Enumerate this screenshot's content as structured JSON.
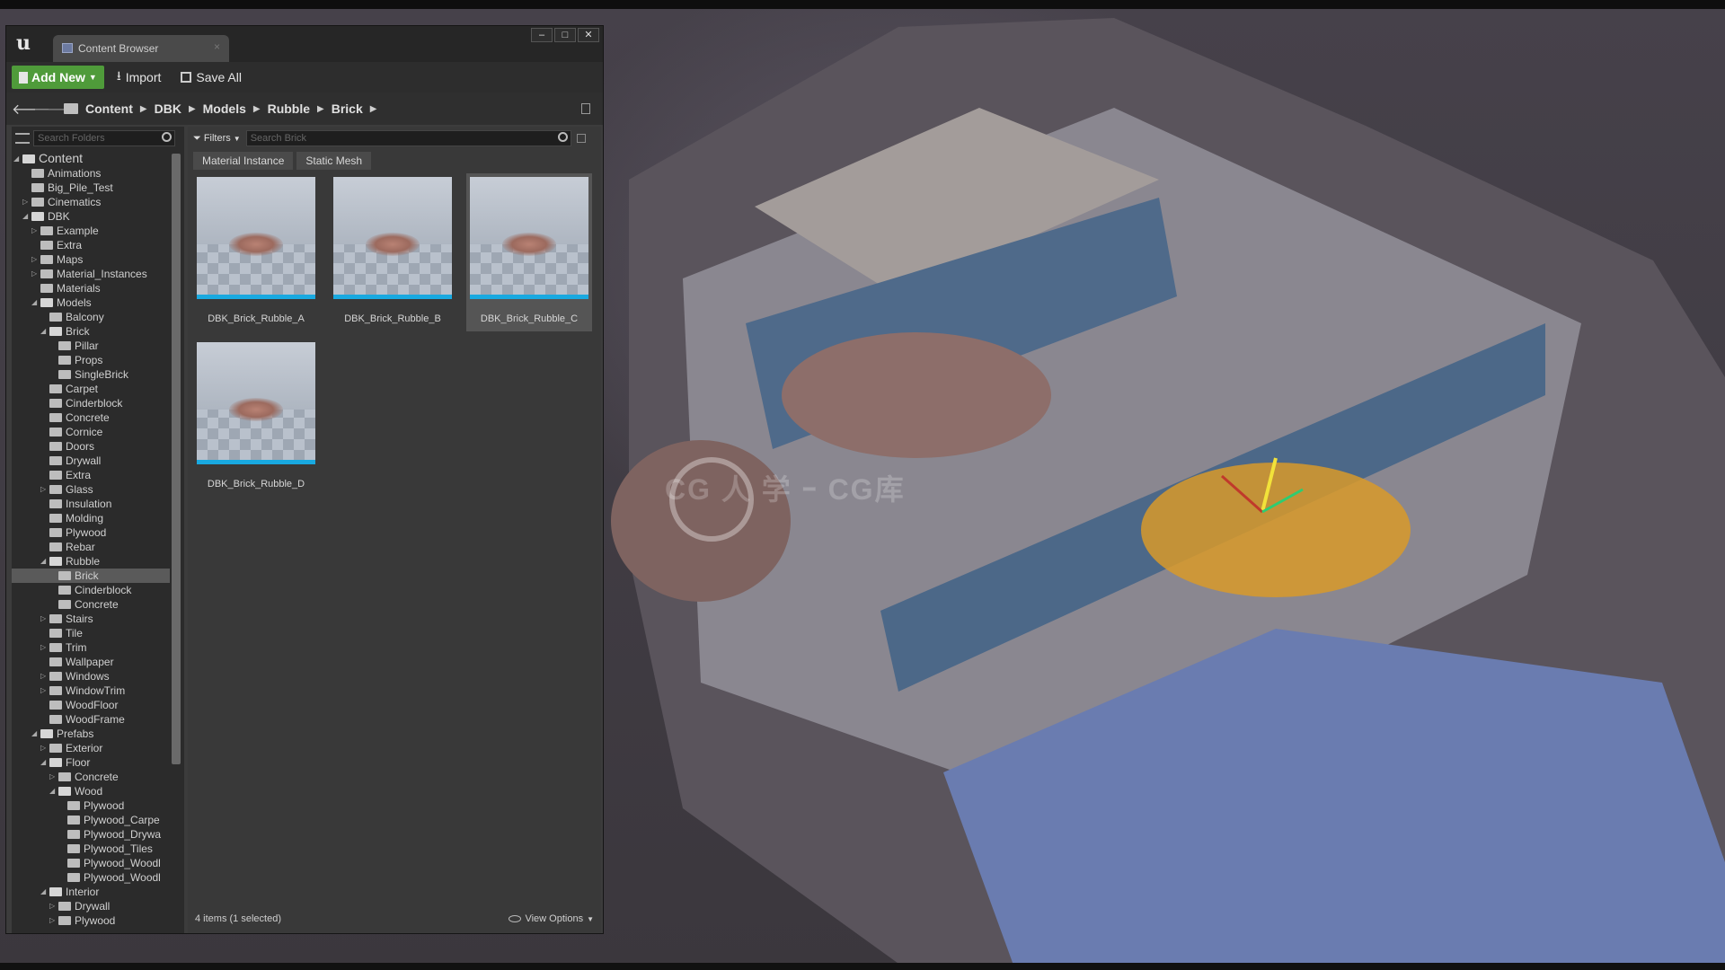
{
  "window": {
    "tab_title": "Content Browser",
    "controls": [
      "–",
      "□",
      "✕"
    ]
  },
  "toolbar": {
    "add_new_label": "Add New",
    "import_label": "Import",
    "save_all_label": "Save All"
  },
  "breadcrumb": [
    "Content",
    "DBK",
    "Models",
    "Rubble",
    "Brick"
  ],
  "folder_search": {
    "placeholder": "Search Folders"
  },
  "asset_search": {
    "placeholder": "Search Brick",
    "filters_label": "Filters"
  },
  "filter_chips": [
    "Material Instance",
    "Static Mesh"
  ],
  "tree": [
    {
      "label": "Content",
      "depth": 0,
      "toggle": "open",
      "root": true
    },
    {
      "label": "Animations",
      "depth": 1
    },
    {
      "label": "Big_Pile_Test",
      "depth": 1
    },
    {
      "label": "Cinematics",
      "depth": 1,
      "toggle": "closed"
    },
    {
      "label": "DBK",
      "depth": 1,
      "toggle": "open"
    },
    {
      "label": "Example",
      "depth": 2,
      "toggle": "closed"
    },
    {
      "label": "Extra",
      "depth": 2
    },
    {
      "label": "Maps",
      "depth": 2,
      "toggle": "closed"
    },
    {
      "label": "Material_Instances",
      "depth": 2,
      "toggle": "closed"
    },
    {
      "label": "Materials",
      "depth": 2
    },
    {
      "label": "Models",
      "depth": 2,
      "toggle": "open"
    },
    {
      "label": "Balcony",
      "depth": 3
    },
    {
      "label": "Brick",
      "depth": 3,
      "toggle": "open"
    },
    {
      "label": "Pillar",
      "depth": 4
    },
    {
      "label": "Props",
      "depth": 4
    },
    {
      "label": "SingleBrick",
      "depth": 4
    },
    {
      "label": "Carpet",
      "depth": 3
    },
    {
      "label": "Cinderblock",
      "depth": 3
    },
    {
      "label": "Concrete",
      "depth": 3
    },
    {
      "label": "Cornice",
      "depth": 3
    },
    {
      "label": "Doors",
      "depth": 3
    },
    {
      "label": "Drywall",
      "depth": 3
    },
    {
      "label": "Extra",
      "depth": 3
    },
    {
      "label": "Glass",
      "depth": 3,
      "toggle": "closed"
    },
    {
      "label": "Insulation",
      "depth": 3
    },
    {
      "label": "Molding",
      "depth": 3
    },
    {
      "label": "Plywood",
      "depth": 3
    },
    {
      "label": "Rebar",
      "depth": 3
    },
    {
      "label": "Rubble",
      "depth": 3,
      "toggle": "open"
    },
    {
      "label": "Brick",
      "depth": 4,
      "selected": true
    },
    {
      "label": "Cinderblock",
      "depth": 4
    },
    {
      "label": "Concrete",
      "depth": 4
    },
    {
      "label": "Stairs",
      "depth": 3,
      "toggle": "closed"
    },
    {
      "label": "Tile",
      "depth": 3
    },
    {
      "label": "Trim",
      "depth": 3,
      "toggle": "closed"
    },
    {
      "label": "Wallpaper",
      "depth": 3
    },
    {
      "label": "Windows",
      "depth": 3,
      "toggle": "closed"
    },
    {
      "label": "WindowTrim",
      "depth": 3,
      "toggle": "closed"
    },
    {
      "label": "WoodFloor",
      "depth": 3
    },
    {
      "label": "WoodFrame",
      "depth": 3
    },
    {
      "label": "Prefabs",
      "depth": 2,
      "toggle": "open"
    },
    {
      "label": "Exterior",
      "depth": 3,
      "toggle": "closed"
    },
    {
      "label": "Floor",
      "depth": 3,
      "toggle": "open"
    },
    {
      "label": "Concrete",
      "depth": 4,
      "toggle": "closed"
    },
    {
      "label": "Wood",
      "depth": 4,
      "toggle": "open"
    },
    {
      "label": "Plywood",
      "depth": 5
    },
    {
      "label": "Plywood_Carpe",
      "depth": 5
    },
    {
      "label": "Plywood_Drywa",
      "depth": 5
    },
    {
      "label": "Plywood_Tiles",
      "depth": 5
    },
    {
      "label": "Plywood_Woodl",
      "depth": 5
    },
    {
      "label": "Plywood_Woodl",
      "depth": 5
    },
    {
      "label": "Interior",
      "depth": 3,
      "toggle": "open"
    },
    {
      "label": "Drywall",
      "depth": 4,
      "toggle": "closed"
    },
    {
      "label": "Plywood",
      "depth": 4,
      "toggle": "closed"
    }
  ],
  "assets": [
    {
      "name": "DBK_Brick_Rubble_A",
      "selected": false
    },
    {
      "name": "DBK_Brick_Rubble_B",
      "selected": false
    },
    {
      "name": "DBK_Brick_Rubble_C",
      "selected": true
    },
    {
      "name": "DBK_Brick_Rubble_D",
      "selected": false
    }
  ],
  "status": {
    "items_text": "4 items (1 selected)",
    "view_options_label": "View Options"
  },
  "viewport": {
    "watermark": "CG 人 学 ｰ CG库"
  }
}
